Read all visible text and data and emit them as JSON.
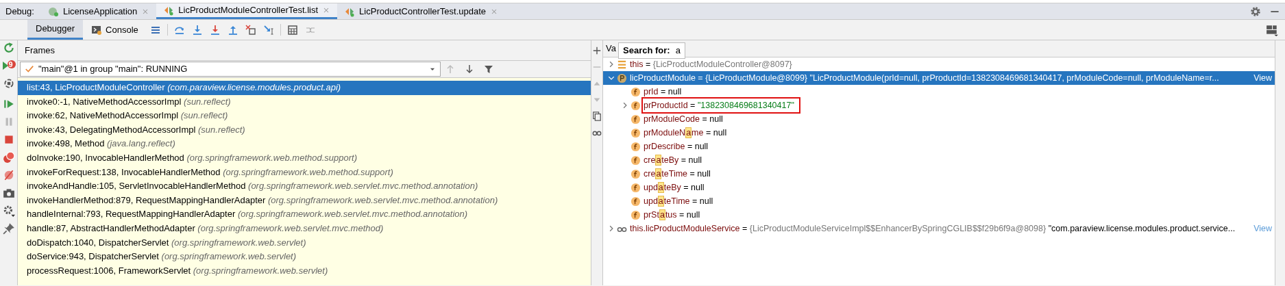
{
  "debug_label": "Debug:",
  "run_tabs": [
    {
      "label": "LicenseApplication",
      "kind": "app",
      "selected": false
    },
    {
      "label": "LicProductModuleControllerTest.list",
      "kind": "test",
      "selected": true
    },
    {
      "label": "LicProductControllerTest.update",
      "kind": "test",
      "selected": false
    }
  ],
  "tool_tabs": [
    {
      "label": "Debugger",
      "kind": "debugger",
      "selected": true
    },
    {
      "label": "Console",
      "kind": "console",
      "selected": false
    }
  ],
  "side_badge": "9",
  "frames": {
    "title": "Frames",
    "thread": "\"main\"@1 in group \"main\": RUNNING",
    "items": [
      {
        "method": "list:43, LicProductModuleController",
        "package": "(com.paraview.license.modules.product.api)",
        "selected": true
      },
      {
        "method": "invoke0:-1, NativeMethodAccessorImpl",
        "package": "(sun.reflect)",
        "selected": false
      },
      {
        "method": "invoke:62, NativeMethodAccessorImpl",
        "package": "(sun.reflect)",
        "selected": false
      },
      {
        "method": "invoke:43, DelegatingMethodAccessorImpl",
        "package": "(sun.reflect)",
        "selected": false
      },
      {
        "method": "invoke:498, Method",
        "package": "(java.lang.reflect)",
        "selected": false
      },
      {
        "method": "doInvoke:190, InvocableHandlerMethod",
        "package": "(org.springframework.web.method.support)",
        "selected": false
      },
      {
        "method": "invokeForRequest:138, InvocableHandlerMethod",
        "package": "(org.springframework.web.method.support)",
        "selected": false
      },
      {
        "method": "invokeAndHandle:105, ServletInvocableHandlerMethod",
        "package": "(org.springframework.web.servlet.mvc.method.annotation)",
        "selected": false
      },
      {
        "method": "invokeHandlerMethod:879, RequestMappingHandlerAdapter",
        "package": "(org.springframework.web.servlet.mvc.method.annotation)",
        "selected": false
      },
      {
        "method": "handleInternal:793, RequestMappingHandlerAdapter",
        "package": "(org.springframework.web.servlet.mvc.method.annotation)",
        "selected": false
      },
      {
        "method": "handle:87, AbstractHandlerMethodAdapter",
        "package": "(org.springframework.web.servlet.mvc.method)",
        "selected": false
      },
      {
        "method": "doDispatch:1040, DispatcherServlet",
        "package": "(org.springframework.web.servlet)",
        "selected": false
      },
      {
        "method": "doService:943, DispatcherServlet",
        "package": "(org.springframework.web.servlet)",
        "selected": false
      },
      {
        "method": "processRequest:1006, FrameworkServlet",
        "package": "(org.springframework.web.servlet)",
        "selected": false
      }
    ]
  },
  "variables": {
    "title": "Va",
    "search_label": "Search for:",
    "search_value": "a",
    "items": [
      {
        "kind": "object",
        "name": [
          "this"
        ],
        "operator": "=",
        "ref": "{LicProductModuleController@8097}",
        "expanded": false,
        "selected": false
      },
      {
        "kind": "param",
        "name": [
          "licProductModule"
        ],
        "operator": "=",
        "ref": "{LicProductModule@8099}",
        "detail": "\"LicProductModule(prId=null, prProductId=1382308469681340417, prModuleCode=null, prModuleName=r...",
        "view": "View",
        "expanded": true,
        "selected": true,
        "children": [
          {
            "kind": "field",
            "name": [
              "prId"
            ],
            "operator": "=",
            "value": "null",
            "selected": false
          },
          {
            "kind": "field",
            "name": [
              "prProductId"
            ],
            "operator": "=",
            "string": "\"1382308469681340417\"",
            "expanded": false,
            "selected": false,
            "boxed": true
          },
          {
            "kind": "field",
            "name": [
              "prModuleCode"
            ],
            "operator": "=",
            "value": "null",
            "selected": false
          },
          {
            "kind": "field",
            "name": [
              "prModuleN",
              "a",
              "me"
            ],
            "operator": "=",
            "value": "null",
            "selected": false
          },
          {
            "kind": "field",
            "name": [
              "prDescribe"
            ],
            "operator": "=",
            "value": "null",
            "selected": false
          },
          {
            "kind": "field",
            "name": [
              "cre",
              "a",
              "teBy"
            ],
            "operator": "=",
            "value": "null",
            "selected": false
          },
          {
            "kind": "field",
            "name": [
              "cre",
              "a",
              "teTime"
            ],
            "operator": "=",
            "value": "null",
            "selected": false
          },
          {
            "kind": "field",
            "name": [
              "upd",
              "a",
              "teBy"
            ],
            "operator": "=",
            "value": "null",
            "selected": false
          },
          {
            "kind": "field",
            "name": [
              "upd",
              "a",
              "teTime"
            ],
            "operator": "=",
            "value": "null",
            "selected": false
          },
          {
            "kind": "field",
            "name": [
              "prSt",
              "a",
              "tus"
            ],
            "operator": "=",
            "value": "null",
            "selected": false
          }
        ]
      },
      {
        "kind": "watch",
        "name": [
          "this.licProductModuleService"
        ],
        "operator": "=",
        "ref": "{LicProductModuleServiceImpl$$EnhancerBySpringCGLIB$$f29b6f9a@8098}",
        "detail": "\"com.paraview.license.modules.product.service...",
        "view": "View",
        "expanded": false,
        "selected": false
      }
    ]
  }
}
